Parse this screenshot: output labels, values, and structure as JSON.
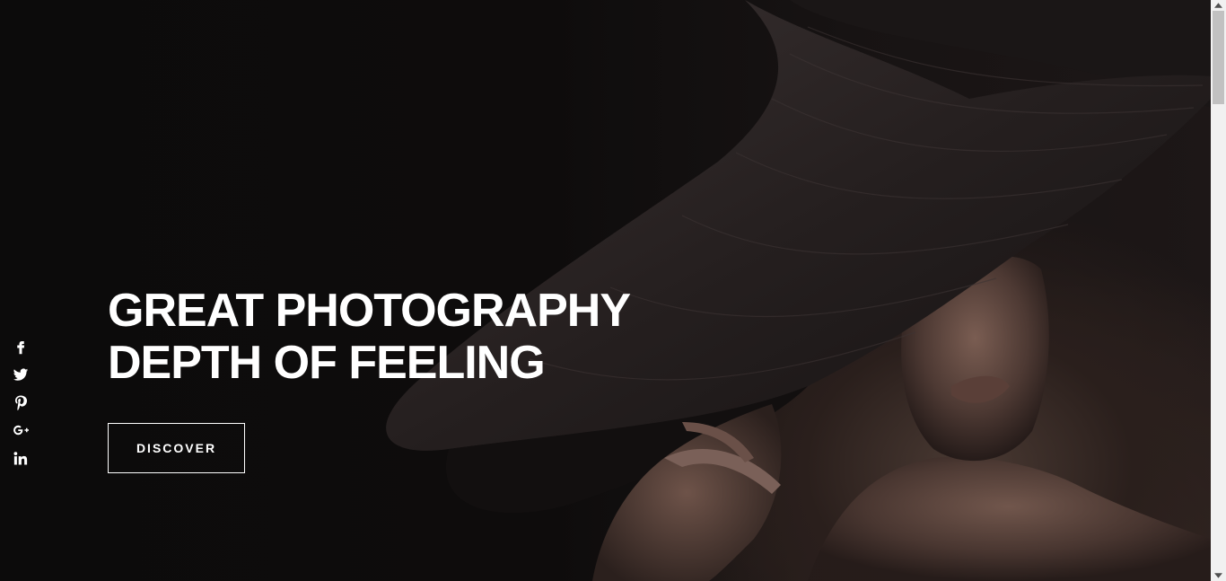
{
  "hero": {
    "headline_line1": "GREAT PHOTOGRAPHY",
    "headline_line2": "DEPTH OF FEELING",
    "button_label": "DISCOVER"
  },
  "social": {
    "items": [
      {
        "name": "facebook",
        "icon": "facebook-icon"
      },
      {
        "name": "twitter",
        "icon": "twitter-icon"
      },
      {
        "name": "pinterest",
        "icon": "pinterest-icon"
      },
      {
        "name": "google-plus",
        "icon": "google-plus-icon"
      },
      {
        "name": "linkedin",
        "icon": "linkedin-icon"
      }
    ]
  },
  "colors": {
    "background": "#0d0b0c",
    "text": "#ffffff",
    "button_border": "#ffffff"
  }
}
